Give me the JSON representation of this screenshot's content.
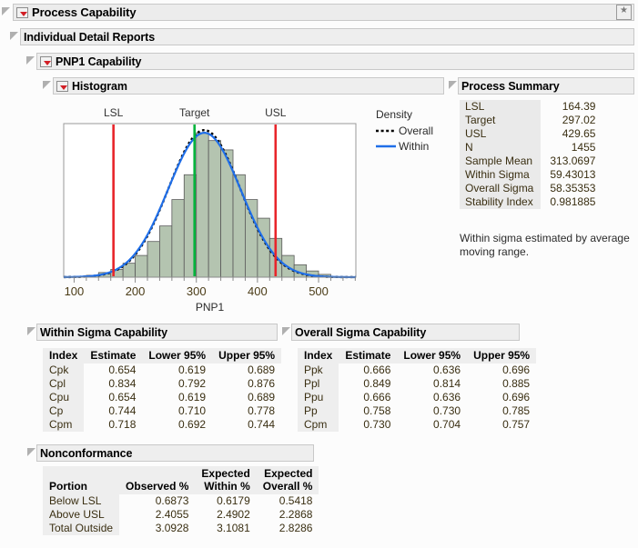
{
  "window": {
    "title": "Process Capability",
    "star_icon": "star-button-icon"
  },
  "outline": {
    "individual_detail_reports": "Individual Detail Reports",
    "pnp1_capability": "PNP1 Capability",
    "histogram": "Histogram",
    "process_summary": "Process Summary",
    "within_sigma_capability": "Within Sigma Capability",
    "overall_sigma_capability": "Overall Sigma Capability",
    "nonconformance": "Nonconformance"
  },
  "process_summary": {
    "rows": [
      {
        "label": "LSL",
        "value": "164.39"
      },
      {
        "label": "Target",
        "value": "297.02"
      },
      {
        "label": "USL",
        "value": "429.65"
      },
      {
        "label": "N",
        "value": "1455"
      },
      {
        "label": "Sample Mean",
        "value": "313.0697"
      },
      {
        "label": "Within Sigma",
        "value": "59.43013"
      },
      {
        "label": "Overall Sigma",
        "value": "58.35353"
      },
      {
        "label": "Stability Index",
        "value": "0.981885"
      }
    ],
    "note": "Within sigma estimated by average moving range."
  },
  "within_sigma": {
    "columns": [
      "Index",
      "Estimate",
      "Lower 95%",
      "Upper 95%"
    ],
    "rows": [
      {
        "index": "Cpk",
        "estimate": "0.654",
        "lower": "0.619",
        "upper": "0.689"
      },
      {
        "index": "Cpl",
        "estimate": "0.834",
        "lower": "0.792",
        "upper": "0.876"
      },
      {
        "index": "Cpu",
        "estimate": "0.654",
        "lower": "0.619",
        "upper": "0.689"
      },
      {
        "index": "Cp",
        "estimate": "0.744",
        "lower": "0.710",
        "upper": "0.778"
      },
      {
        "index": "Cpm",
        "estimate": "0.718",
        "lower": "0.692",
        "upper": "0.744"
      }
    ]
  },
  "overall_sigma": {
    "columns": [
      "Index",
      "Estimate",
      "Lower 95%",
      "Upper 95%"
    ],
    "rows": [
      {
        "index": "Ppk",
        "estimate": "0.666",
        "lower": "0.636",
        "upper": "0.696"
      },
      {
        "index": "Ppl",
        "estimate": "0.849",
        "lower": "0.814",
        "upper": "0.885"
      },
      {
        "index": "Ppu",
        "estimate": "0.666",
        "lower": "0.636",
        "upper": "0.696"
      },
      {
        "index": "Pp",
        "estimate": "0.758",
        "lower": "0.730",
        "upper": "0.785"
      },
      {
        "index": "Cpm",
        "estimate": "0.730",
        "lower": "0.704",
        "upper": "0.757"
      }
    ]
  },
  "nonconformance": {
    "columns": [
      "Portion",
      "Observed %",
      "Expected Within %",
      "Expected Overall %"
    ],
    "columns_wrapped": [
      {
        "l1": "",
        "l2": "Portion"
      },
      {
        "l1": "",
        "l2": "Observed %"
      },
      {
        "l1": "Expected",
        "l2": "Within %"
      },
      {
        "l1": "Expected",
        "l2": "Overall %"
      }
    ],
    "rows": [
      {
        "portion": "Below LSL",
        "observed": "0.6873",
        "within": "0.6179",
        "overall": "0.5418"
      },
      {
        "portion": "Above USL",
        "observed": "2.4055",
        "within": "2.4902",
        "overall": "2.2868"
      },
      {
        "portion": "Total Outside",
        "observed": "3.0928",
        "within": "3.1081",
        "overall": "2.8286"
      }
    ]
  },
  "chart_data": {
    "type": "bar",
    "title": "",
    "xlabel": "PNP1",
    "ylabel": "Density",
    "xlim": [
      83,
      561
    ],
    "xticks": [
      100,
      200,
      300,
      400,
      500
    ],
    "grid": false,
    "bin_width": 20,
    "bin_starts": [
      120,
      140,
      160,
      180,
      200,
      220,
      240,
      260,
      280,
      300,
      320,
      340,
      360,
      380,
      400,
      420,
      440,
      460,
      480,
      500
    ],
    "counts_normalized": [
      0.012,
      0.03,
      0.05,
      0.09,
      0.14,
      0.23,
      0.33,
      0.5,
      0.66,
      0.93,
      0.88,
      0.82,
      0.66,
      0.5,
      0.38,
      0.25,
      0.14,
      0.08,
      0.04,
      0.018
    ],
    "reference_lines": [
      {
        "label": "LSL",
        "value": 164.39,
        "color": "#e8252b"
      },
      {
        "label": "Target",
        "value": 297.02,
        "color": "#00b43c"
      },
      {
        "label": "USL",
        "value": 429.65,
        "color": "#e8252b"
      }
    ],
    "legend": {
      "title": "Density",
      "position": "right",
      "entries": [
        {
          "name": "Overall",
          "style": "dotted",
          "color": "#000000"
        },
        {
          "name": "Within",
          "style": "solid",
          "color": "#1f6ee8"
        }
      ]
    },
    "curves": [
      {
        "name": "Overall",
        "mean": 313.07,
        "sigma": 58.35353,
        "color": "#000000",
        "style": "dotted"
      },
      {
        "name": "Within",
        "mean": 313.07,
        "sigma": 59.43013,
        "color": "#1f6ee8",
        "style": "solid"
      }
    ],
    "bar_fill": "#b4c4b0",
    "bar_stroke": "#5a5a5a"
  }
}
